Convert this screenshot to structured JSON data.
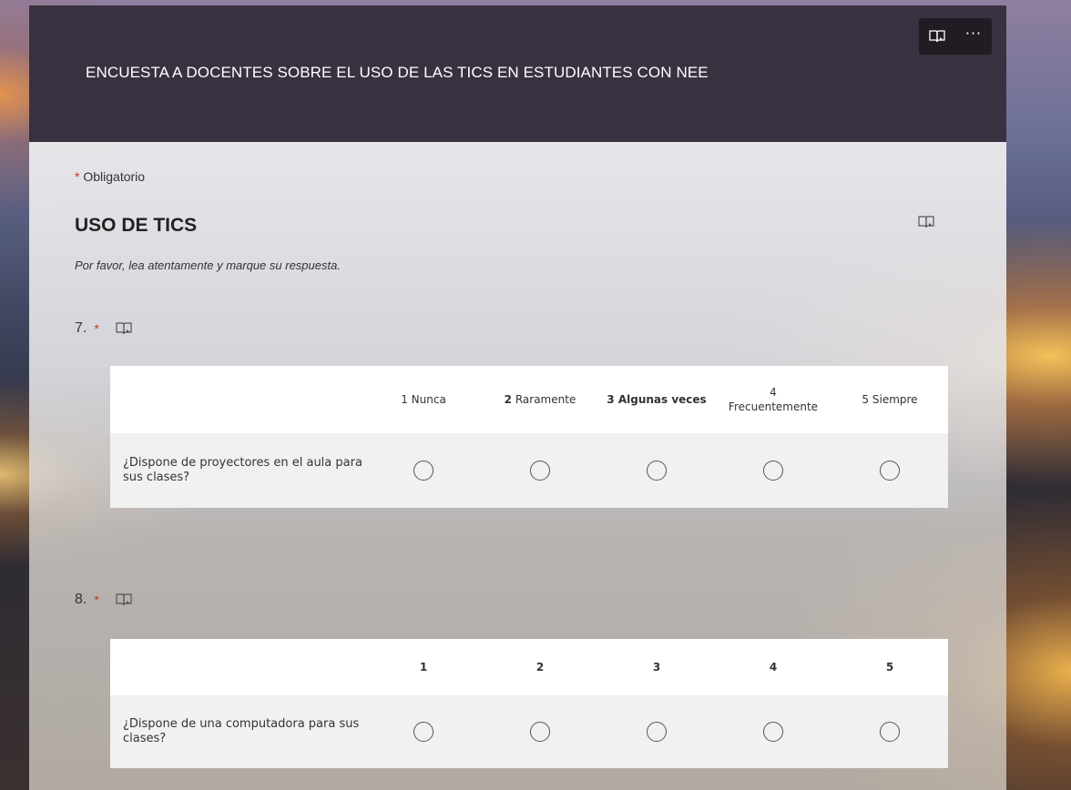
{
  "header": {
    "title": "ENCUESTA A DOCENTES SOBRE EL USO DE LAS TICS EN ESTUDIANTES CON NEE",
    "tools": [
      "immersive-reader-icon",
      "more-options-icon"
    ],
    "more_label": "···"
  },
  "form": {
    "required_star": "*",
    "required_note": "Obligatorio",
    "section_title": "USO DE TICS",
    "section_description": "Por favor, lea atentamente y marque su respuesta."
  },
  "questions": [
    {
      "number": "7.",
      "required_star": "*",
      "columns": [
        {
          "label": "1 Nunca"
        },
        {
          "prefix": "2",
          "label": "Raramente"
        },
        {
          "label": "3 Algunas veces"
        },
        {
          "label": "4 Frecuentemente",
          "lines": [
            "4",
            "Frecuentemente"
          ]
        },
        {
          "label": "5 Siempre"
        }
      ],
      "rows": [
        {
          "label": "¿Dispone de proyectores en el aula para sus clases?",
          "selected": null
        }
      ]
    },
    {
      "number": "8.",
      "required_star": "*",
      "columns": [
        {
          "label": "1"
        },
        {
          "label": "2"
        },
        {
          "label": "3"
        },
        {
          "label": "4"
        },
        {
          "label": "5"
        }
      ],
      "rows": [
        {
          "label": "¿Dispone de una computadora para sus clases?",
          "selected": null
        }
      ]
    }
  ],
  "colors": {
    "header_bg": "#3a3140",
    "required": "#c2392b",
    "tools_bg": "#211c24"
  }
}
